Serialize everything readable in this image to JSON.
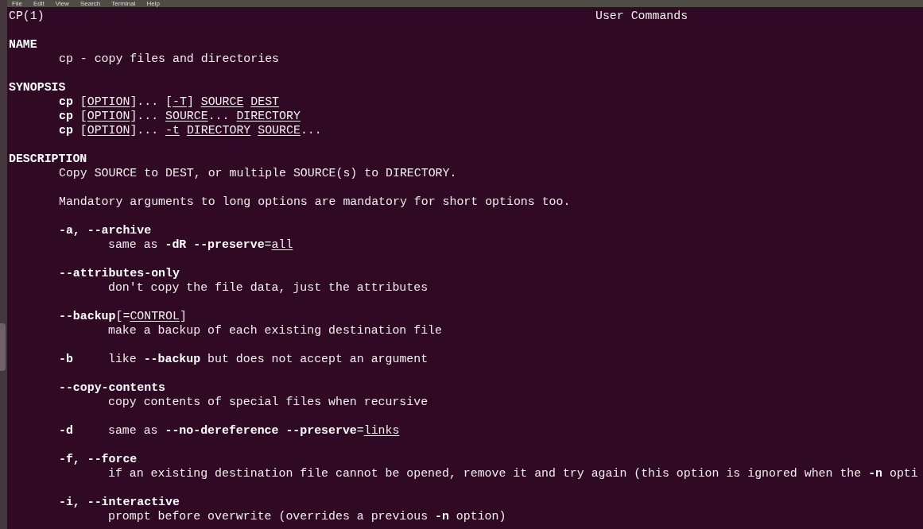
{
  "menu_bar": [
    "File",
    "Edit",
    "View",
    "Search",
    "Terminal",
    "Help"
  ],
  "header": {
    "left": "CP(1)",
    "center": "User Commands"
  },
  "sections": [
    {
      "heading": "NAME",
      "blocks": [
        {
          "kind": "para",
          "lines": [
            [
              {
                "text": "cp - copy files and directories",
                "kind": "plain"
              }
            ]
          ]
        }
      ]
    },
    {
      "heading": "SYNOPSIS",
      "blocks": [
        {
          "kind": "para",
          "lines": [
            [
              {
                "text": "cp",
                "kind": "bold"
              },
              {
                "text": " [",
                "kind": "plain"
              },
              {
                "text": "OPTION",
                "kind": "underline"
              },
              {
                "text": "]... [",
                "kind": "plain"
              },
              {
                "text": "-T",
                "kind": "underline"
              },
              {
                "text": "] ",
                "kind": "plain"
              },
              {
                "text": "SOURCE ",
                "kind": "underline"
              },
              {
                "text": "DEST",
                "kind": "underline"
              }
            ],
            [
              {
                "text": "cp",
                "kind": "bold"
              },
              {
                "text": " [",
                "kind": "plain"
              },
              {
                "text": "OPTION",
                "kind": "underline"
              },
              {
                "text": "]... ",
                "kind": "plain"
              },
              {
                "text": "SOURCE",
                "kind": "underline"
              },
              {
                "text": "... ",
                "kind": "plain"
              },
              {
                "text": "DIRECTORY",
                "kind": "underline"
              }
            ],
            [
              {
                "text": "cp",
                "kind": "bold"
              },
              {
                "text": " [",
                "kind": "plain"
              },
              {
                "text": "OPTION",
                "kind": "underline"
              },
              {
                "text": "]... ",
                "kind": "plain"
              },
              {
                "text": "-t ",
                "kind": "underline"
              },
              {
                "text": "DIRECTORY ",
                "kind": "underline"
              },
              {
                "text": "SOURCE",
                "kind": "underline"
              },
              {
                "text": "...",
                "kind": "plain"
              }
            ]
          ]
        }
      ]
    },
    {
      "heading": "DESCRIPTION",
      "blocks": [
        {
          "kind": "para",
          "lines": [
            [
              {
                "text": "Copy SOURCE to DEST, or multiple SOURCE(s) to DIRECTORY.",
                "kind": "plain"
              }
            ]
          ]
        },
        {
          "kind": "para",
          "lines": [
            [
              {
                "text": "Mandatory arguments to long options are mandatory for short options too.",
                "kind": "plain"
              }
            ]
          ]
        },
        {
          "kind": "option",
          "term": [
            {
              "text": "-a, --archive",
              "kind": "bold"
            }
          ],
          "desc": [
            {
              "text": "same as ",
              "kind": "plain"
            },
            {
              "text": "-dR --preserve",
              "kind": "bold"
            },
            {
              "text": "=",
              "kind": "plain"
            },
            {
              "text": "all",
              "kind": "underline"
            }
          ]
        },
        {
          "kind": "option",
          "term": [
            {
              "text": "--attributes-only",
              "kind": "bold"
            }
          ],
          "desc": [
            {
              "text": "don't copy the file data, just the attributes",
              "kind": "plain"
            }
          ]
        },
        {
          "kind": "option",
          "term": [
            {
              "text": "--backup",
              "kind": "bold"
            },
            {
              "text": "[=",
              "kind": "plain"
            },
            {
              "text": "CONTROL",
              "kind": "underline"
            },
            {
              "text": "]",
              "kind": "plain"
            }
          ],
          "desc": [
            {
              "text": "make a backup of each existing destination file",
              "kind": "plain"
            }
          ]
        },
        {
          "kind": "option_inline",
          "term": [
            {
              "text": "-b",
              "kind": "bold"
            }
          ],
          "desc": [
            {
              "text": "like ",
              "kind": "plain"
            },
            {
              "text": "--backup",
              "kind": "bold"
            },
            {
              "text": " but does not accept an argument",
              "kind": "plain"
            }
          ]
        },
        {
          "kind": "option",
          "term": [
            {
              "text": "--copy-contents",
              "kind": "bold"
            }
          ],
          "desc": [
            {
              "text": "copy contents of special files when recursive",
              "kind": "plain"
            }
          ]
        },
        {
          "kind": "option_inline",
          "term": [
            {
              "text": "-d",
              "kind": "bold"
            }
          ],
          "desc": [
            {
              "text": "same as ",
              "kind": "plain"
            },
            {
              "text": "--no-dereference --preserve",
              "kind": "bold"
            },
            {
              "text": "=",
              "kind": "plain"
            },
            {
              "text": "links",
              "kind": "underline"
            }
          ]
        },
        {
          "kind": "option",
          "term": [
            {
              "text": "-f, --force",
              "kind": "bold"
            }
          ],
          "desc": [
            {
              "text": "if an existing destination file cannot be opened, remove it and try again (this option is ignored when the ",
              "kind": "plain"
            },
            {
              "text": "-n",
              "kind": "bold"
            },
            {
              "text": " opti",
              "kind": "plain"
            }
          ]
        },
        {
          "kind": "option",
          "term": [
            {
              "text": "-i, --interactive",
              "kind": "bold"
            }
          ],
          "desc": [
            {
              "text": "prompt before overwrite (overrides a previous ",
              "kind": "plain"
            },
            {
              "text": "-n",
              "kind": "bold"
            },
            {
              "text": " option)",
              "kind": "plain"
            }
          ]
        }
      ]
    }
  ]
}
